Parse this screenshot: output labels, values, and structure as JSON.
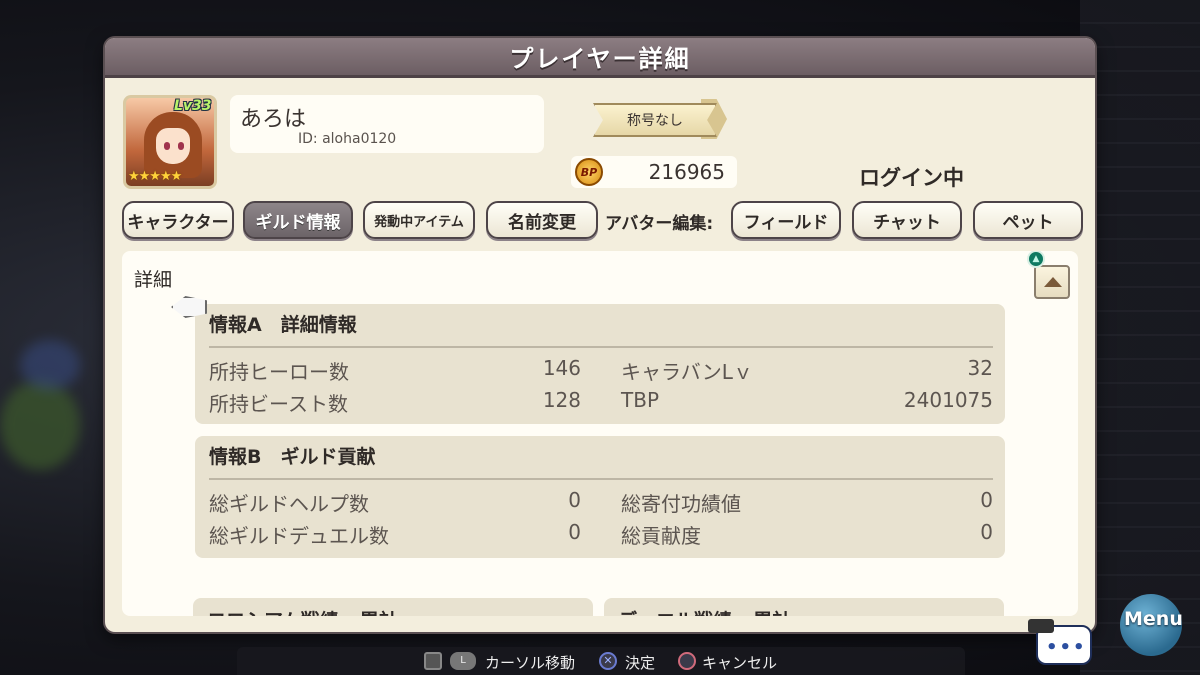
{
  "window": {
    "title": "プレイヤー詳細"
  },
  "profile": {
    "level": "Lv33",
    "stars": "★★★★★",
    "name": "あろは",
    "id": "ID: aloha0120",
    "title_badge": "称号なし",
    "bp_icon": "BP",
    "bp_value": "216965",
    "status": "ログイン中"
  },
  "buttons": {
    "character": "キャラクター",
    "guild_info": "ギルド情報",
    "active_items": "発動中アイテム",
    "rename": "名前変更",
    "avatar_edit_label": "アバター編集:",
    "field": "フィールド",
    "chat": "チャット",
    "pet": "ペット"
  },
  "detail": {
    "header": "詳細",
    "info_a": {
      "title": "情報A　詳細情報",
      "rows": [
        {
          "label": "所持ヒーロー数",
          "value": "146",
          "label2": "キャラバンLｖ",
          "value2": "32"
        },
        {
          "label": "所持ビースト数",
          "value": "128",
          "label2": "TBP",
          "value2": "2401075"
        }
      ]
    },
    "info_b": {
      "title": "情報B　ギルド貢献",
      "rows": [
        {
          "label": "総ギルドヘルプ数",
          "value": "0",
          "label2": "総寄付功績値",
          "value2": "0"
        },
        {
          "label": "総ギルドデュエル数",
          "value": "0",
          "label2": "総貢献度",
          "value2": "0"
        }
      ]
    },
    "colosseum_title": "コロシアム戦績 - 累計",
    "duel_title": "デュエル戦績 - 累計"
  },
  "controls": {
    "l_button": "L",
    "move": "カーソル移動",
    "confirm": "決定",
    "cancel": "キャンセル"
  },
  "menu_label": "Menu",
  "chat_dots": "•••",
  "icons": [
    "triangle-button-icon",
    "scroll-up-icon",
    "bp-coin-icon",
    "cursor-pointer-icon",
    "dpad-icon",
    "cross-button-icon",
    "circle-button-icon",
    "chat-icon"
  ]
}
